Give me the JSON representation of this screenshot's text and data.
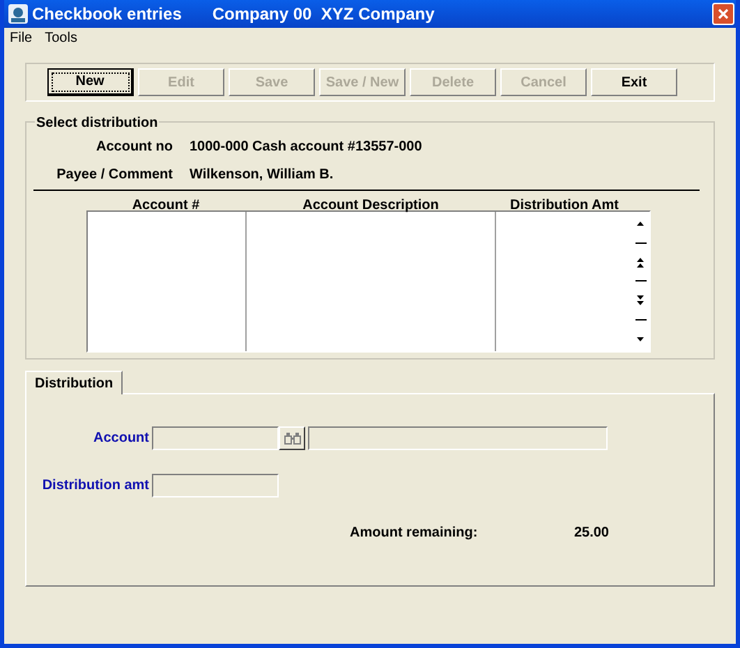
{
  "window": {
    "title": "Checkbook entries",
    "subtitle": "Company 00  XYZ Company"
  },
  "menu": [
    "File",
    "Tools"
  ],
  "buttons": [
    {
      "label": "New",
      "disabled": false,
      "focused": true
    },
    {
      "label": "Edit",
      "disabled": true,
      "focused": false
    },
    {
      "label": "Save",
      "disabled": true,
      "focused": false
    },
    {
      "label": "Save / New",
      "disabled": true,
      "focused": false
    },
    {
      "label": "Delete",
      "disabled": true,
      "focused": false
    },
    {
      "label": "Cancel",
      "disabled": true,
      "focused": false
    },
    {
      "label": "Exit",
      "disabled": false,
      "focused": false
    }
  ],
  "select_distribution": {
    "title": "Select distribution",
    "fields": [
      {
        "label": "Account no",
        "value": "1000-000 Cash account #13557-000"
      },
      {
        "label": "Payee / Comment",
        "value": "Wilkenson, William B."
      }
    ],
    "table": {
      "columns": [
        "Account #",
        "Account Description",
        "Distribution Amt"
      ]
    }
  },
  "tabs": [
    {
      "label": "Distribution",
      "selected": true
    }
  ],
  "distribution": {
    "account_label": "Account",
    "distribution_amt_label": "Distribution amt",
    "amount_remaining_label": "Amount remaining:",
    "amount_remaining": "25.00"
  }
}
